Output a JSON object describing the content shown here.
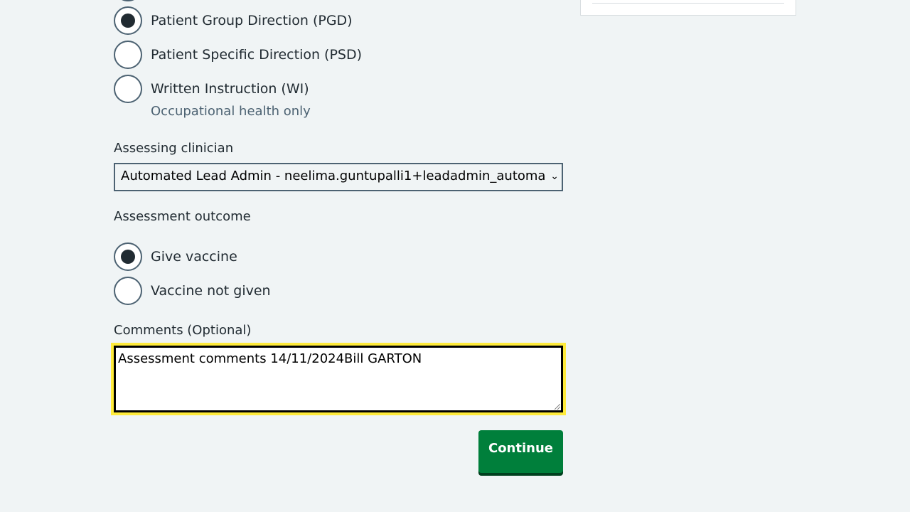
{
  "vaccination_protocol": {
    "options": [
      {
        "label": "Patient Group Direction (PGD)",
        "checked": true
      },
      {
        "label": "Patient Specific Direction (PSD)",
        "checked": false
      },
      {
        "label": "Written Instruction (WI)",
        "hint": "Occupational health only",
        "checked": false
      }
    ]
  },
  "assessing_clinician": {
    "label": "Assessing clinician",
    "selected": "Automated Lead Admin - neelima.guntupalli1+leadadmin_automa"
  },
  "assessment_outcome": {
    "label": "Assessment outcome",
    "options": [
      {
        "label": "Give vaccine",
        "checked": true
      },
      {
        "label": "Vaccine not given",
        "checked": false
      }
    ]
  },
  "comments": {
    "label": "Comments (Optional)",
    "value": "Assessment comments 14/11/2024Bill GARTON"
  },
  "continue_button": {
    "label": "Continue"
  },
  "icons": {
    "select_chevron": "chevron-down-icon"
  },
  "colors": {
    "primary_button": "#007f3b",
    "focus": "#ffeb3b",
    "background": "#f0f4f5"
  }
}
